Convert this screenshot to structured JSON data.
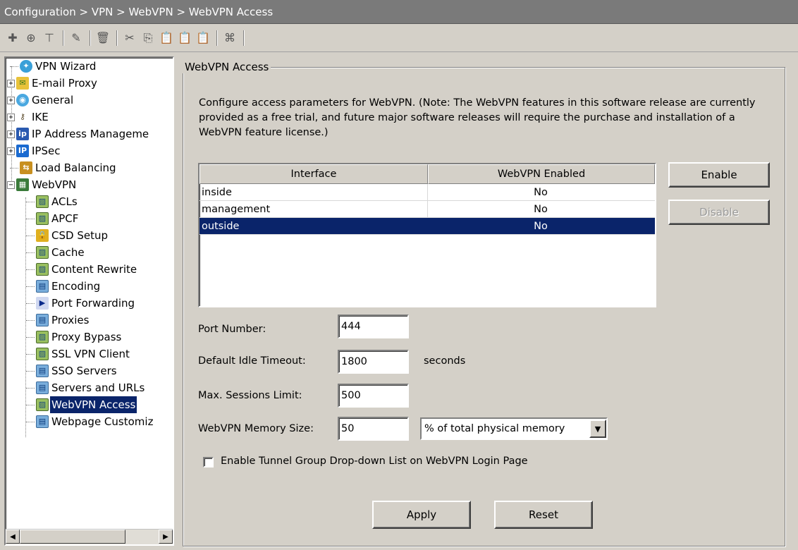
{
  "title_bar": "Configuration > VPN > WebVPN > WebVPN Access",
  "toolbar": {
    "buttons": [
      {
        "icon": "add-icon",
        "glyph": "✚"
      },
      {
        "icon": "insert-after-icon",
        "glyph": "⊕"
      },
      {
        "icon": "insert-before-icon",
        "glyph": "⊤"
      },
      {
        "icon": "edit-icon",
        "glyph": "✎"
      },
      {
        "icon": "delete-icon",
        "glyph": "🗑"
      },
      {
        "icon": "cut-icon",
        "glyph": "✂"
      },
      {
        "icon": "copy-icon",
        "glyph": "⎘"
      },
      {
        "icon": "paste-icon",
        "glyph": "📋"
      },
      {
        "icon": "paste-after-icon",
        "glyph": "📋"
      },
      {
        "icon": "paste-before-icon",
        "glyph": "📋"
      },
      {
        "icon": "find-icon",
        "glyph": "⌘"
      }
    ]
  },
  "tree": {
    "items": [
      {
        "label": "VPN Wizard",
        "icon": "wizard-icon",
        "glyph": "✦"
      },
      {
        "label": "E-mail Proxy",
        "icon": "mail-icon",
        "glyph": "✉"
      },
      {
        "label": "General",
        "icon": "general-icon",
        "glyph": "◉"
      },
      {
        "label": "IKE",
        "icon": "key-icon",
        "glyph": "⚷"
      },
      {
        "label": "IP Address Manageme",
        "icon": "ip-address-icon",
        "glyph": "ip"
      },
      {
        "label": "IPSec",
        "icon": "ipsec-icon",
        "glyph": "IP"
      },
      {
        "label": "Load Balancing",
        "icon": "load-balancing-icon",
        "glyph": "⇆"
      },
      {
        "label": "WebVPN",
        "icon": "webvpn-icon",
        "glyph": "▦"
      },
      {
        "label": "ACLs",
        "icon": "acl-icon",
        "glyph": "▨"
      },
      {
        "label": "APCF",
        "icon": "apcf-icon",
        "glyph": "▨"
      },
      {
        "label": "CSD Setup",
        "icon": "lock-icon",
        "glyph": "🔒"
      },
      {
        "label": "Cache",
        "icon": "cache-icon",
        "glyph": "▨"
      },
      {
        "label": "Content Rewrite",
        "icon": "content-rewrite-icon",
        "glyph": "▨"
      },
      {
        "label": "Encoding",
        "icon": "encoding-icon",
        "glyph": "▤"
      },
      {
        "label": "Port Forwarding",
        "icon": "port-forwarding-icon",
        "glyph": "▶"
      },
      {
        "label": "Proxies",
        "icon": "proxies-icon",
        "glyph": "▤"
      },
      {
        "label": "Proxy Bypass",
        "icon": "proxy-bypass-icon",
        "glyph": "▨"
      },
      {
        "label": "SSL VPN Client",
        "icon": "ssl-vpn-client-icon",
        "glyph": "▨"
      },
      {
        "label": "SSO Servers",
        "icon": "sso-servers-icon",
        "glyph": "▤"
      },
      {
        "label": "Servers and URLs",
        "icon": "servers-icon",
        "glyph": "▤"
      },
      {
        "label": "WebVPN Access",
        "icon": "webvpn-access-icon",
        "glyph": "▨"
      },
      {
        "label": "Webpage Customiz",
        "icon": "webpage-icon",
        "glyph": "▤"
      }
    ],
    "expand_plus": "+",
    "expand_minus": "−",
    "scroll_left": "◀",
    "scroll_right": "▶"
  },
  "panel": {
    "group_title": "WebVPN Access",
    "description": "Configure access parameters for WebVPN. (Note: The WebVPN features in this software release are currently provided as a free trial, and future major software releases will require the purchase and installation of a WebVPN feature license.)",
    "table": {
      "columns": [
        "Interface",
        "WebVPN Enabled"
      ],
      "rows": [
        {
          "interface": "inside",
          "enabled": "No"
        },
        {
          "interface": "management",
          "enabled": "No"
        },
        {
          "interface": "outside",
          "enabled": "No"
        }
      ]
    },
    "enable_label": "Enable",
    "disable_label": "Disable",
    "port_label": "Port Number:",
    "port_value": "444",
    "idle_label": "Default Idle Timeout:",
    "idle_value": "1800",
    "idle_unit": "seconds",
    "sessions_label": "Max. Sessions Limit:",
    "sessions_value": "500",
    "memory_label": "WebVPN Memory Size:",
    "memory_value": "50",
    "memory_unit_selected": "% of total physical memory",
    "tunnel_checkbox_label": "Enable Tunnel Group Drop-down List on WebVPN Login Page",
    "tunnel_checked": false,
    "apply_label": "Apply",
    "reset_label": "Reset"
  }
}
